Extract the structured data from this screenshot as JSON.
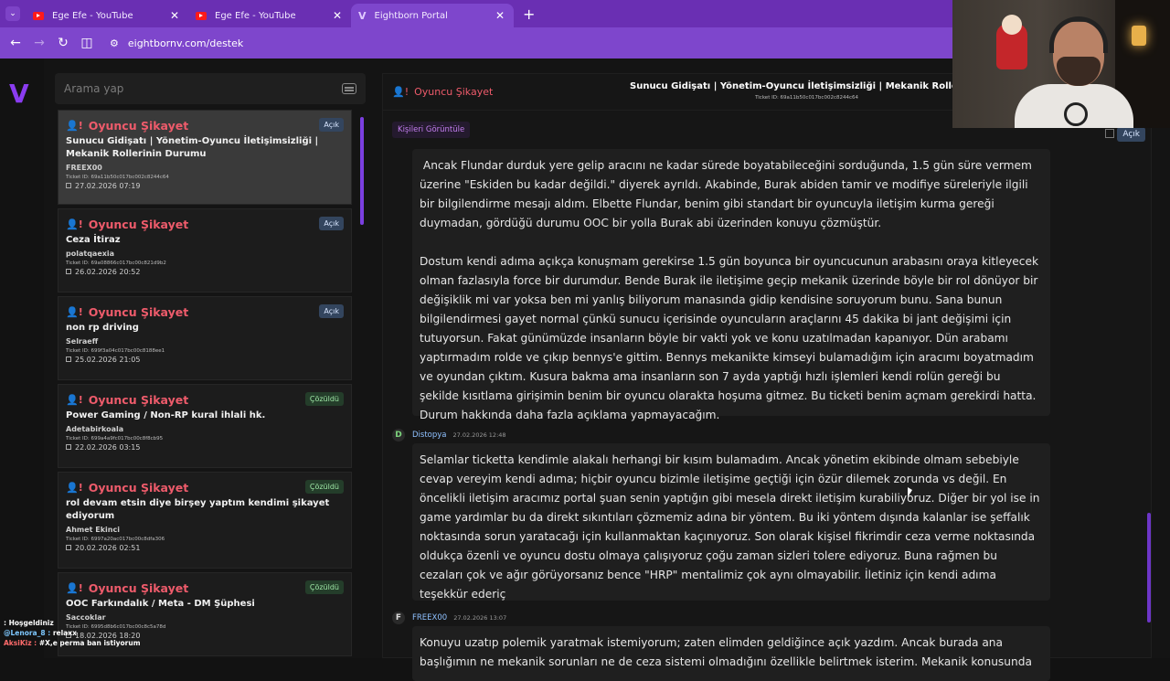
{
  "browser": {
    "tabs": [
      {
        "title": "Ege Efe - YouTube",
        "icon": "youtube-icon",
        "active": false
      },
      {
        "title": "Ege Efe - YouTube",
        "icon": "youtube-icon",
        "active": false
      },
      {
        "title": "Eightborn Portal",
        "icon": "v-logo-icon",
        "active": true
      }
    ],
    "url": "eightbornv.com/destek"
  },
  "search": {
    "placeholder": "Arama yap"
  },
  "tickets": [
    {
      "category": "Oyuncu Şikayet",
      "status": "Açık",
      "subject": "Sunucu Gidişatı | Yönetim-Oyuncu İletişimsizliği | Mekanik Rollerinin Durumu",
      "user": "FREEX00",
      "ticket_id": "Ticket ID: 69a11b50c017bc002c8244c64",
      "date": "27.02.2026 07:19"
    },
    {
      "category": "Oyuncu Şikayet",
      "status": "Açık",
      "subject": "Ceza İtiraz",
      "user": "polatqaexia",
      "ticket_id": "Ticket ID: 69a08866c017bc00c821d9b2",
      "date": "26.02.2026 20:52"
    },
    {
      "category": "Oyuncu Şikayet",
      "status": "Açık",
      "subject": "non rp driving",
      "user": "Selraeff",
      "ticket_id": "Ticket ID: 699f3a04c017bc00c8188ee1",
      "date": "25.02.2026 21:05"
    },
    {
      "category": "Oyuncu Şikayet",
      "status": "Çözüldü",
      "subject": "Power Gaming / Non-RP kural ihlali hk.",
      "user": "Adetabirkoala",
      "ticket_id": "Ticket ID: 699a4a9fc017bc00c8f8cb95",
      "date": "22.02.2026 03:15"
    },
    {
      "category": "Oyuncu Şikayet",
      "status": "Çözüldü",
      "subject": "rol devam etsin diye birşey yaptım kendimi şikayet ediyorum",
      "user": "Ahmet Ekinci",
      "ticket_id": "Ticket ID: 6997a20ac017bc00c8dfa306",
      "date": "20.02.2026 02:51"
    },
    {
      "category": "Oyuncu Şikayet",
      "status": "Çözüldü",
      "subject": "OOC Farkındalık / Meta - DM Şüphesi",
      "user": "Saccoklar",
      "ticket_id": "Ticket ID: 6995d8b6c017bc00c8c5a78d",
      "date": "18.02.2026 18:20"
    }
  ],
  "detail": {
    "category": "Oyuncu Şikayet",
    "title": "Sunucu Gidişatı | Yönetim-Oyuncu İletişimsizliği | Mekanik Rollerinin Dur",
    "ticket_id": "Ticket ID: 69a11b50c017bc002c8244c64",
    "people_button": "Kişileri Görüntüle",
    "status": "Açık",
    "messages": [
      {
        "text": " Ancak Flundar durduk yere gelip aracını ne kadar sürede boyatabileceğini sorduğunda, 1.5 gün süre vermem üzerine \"Eskiden bu kadar değildi.\" diyerek ayrıldı. Akabinde, Burak abiden tamir ve modifiye süreleriyle ilgili bir bilgilendirme mesajı aldım. Elbette Flundar, benim gibi standart bir oyuncuyla iletişim kurma gereği duymadan, gördüğü durumu OOC bir yolla Burak abi üzerinden konuyu çözmüştür."
      },
      {
        "text": "Dostum kendi adıma açıkça konuşmam gerekirse 1.5 gün boyunca bir oyuncucunun arabasını oraya kitleyecek olman fazlasıyla force bir durumdur. Bende Burak ile iletişime geçip mekanik üzerinde böyle bir rol dönüyor bir değişiklik mi var yoksa ben mi yanlış biliyorum manasında gidip kendisine soruyorum bunu. Sana bunun bilgilendirmesi gayet normal çünkü sunucu içerisinde oyuncuların araçlarını 45 dakika bi jant değişimi için tutuyorsun. Fakat günümüzde insanların böyle bir vakti yok ve konu uzatılmadan kapanıyor. Dün arabamı yaptırmadım rolde ve çıkıp bennys'e gittim. Bennys mekanikte kimseyi bulamadığım için aracımı boyatmadım ve oyundan çıktım. Kusura bakma ama insanların son 7 ayda yaptığı hızlı işlemleri kendi rolün gereği bu şekilde kısıtlama girişimin benim bir oyuncu olarakta hoşuma gitmez. Bu ticketi benim açmam gerekirdi hatta. Durum hakkında daha fazla açıklama yapmayacağım."
      },
      {
        "author": "Distopya",
        "avatar": "D",
        "time": "27.02.2026 12:48",
        "text": "Selamlar ticketta kendimle alakalı herhangi bir kısım bulamadım. Ancak yönetim ekibinde olmam sebebiyle cevap vereyim kendi adıma; hiçbir oyuncu bizimle iletişime geçtiği için özür dilemek zorunda vs değil. En öncelikli iletişim aracımız portal şuan senin yaptığın gibi mesela direkt iletişim kurabiliyoruz. Diğer bir yol ise in game yardımlar bu da direkt sıkıntıları çözmemiz adına bir yöntem. Bu iki yöntem dışında kalanlar ise şeffalık noktasında sorun yaratacağı için kullanmaktan kaçınıyoruz. Son olarak kişisel fikrimdir ceza verme noktasında oldukça özenli ve oyuncu dostu olmaya çalışıyoruz çoğu zaman sizleri tolere ediyoruz. Buna rağmen bu cezaları çok ve ağır görüyorsanız bence \"HRP\" mentalimiz çok aynı olmayabilir. İletiniz için kendi adıma teşekkür ederiç"
      },
      {
        "author": "FREEX00",
        "avatar": "F",
        "time": "27.02.2026 13:07",
        "text": "Konuyu uzatıp polemik yaratmak istemiyorum; zaten elimden geldiğince açık yazdım. Ancak burada ana başlığımın ne mekanik sorunları ne de ceza sistemi olmadığını özellikle belirtmek isterim. Mekanik konusunda"
      }
    ]
  },
  "chat": [
    {
      "user": "@Lenora_8 :",
      "text": "relaxx"
    },
    {
      "user": "AksiKiz :",
      "text": "#X,e perma ban istiyorum"
    },
    {
      "user": "",
      "text": ": Hoşgeldiniz"
    }
  ]
}
